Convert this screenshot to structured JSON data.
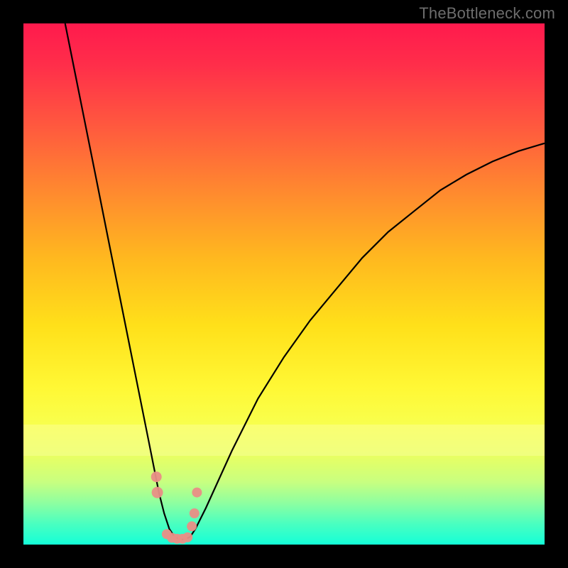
{
  "watermark": {
    "text": "TheBottleneck.com"
  },
  "chart_data": {
    "type": "line",
    "title": "",
    "xlabel": "",
    "ylabel": "",
    "xlim": [
      0,
      100
    ],
    "ylim": [
      0,
      100
    ],
    "grid": false,
    "legend": false,
    "background_gradient": {
      "orientation": "vertical",
      "top_color": "#ff1a4d",
      "bottom_color": "#14ffd8"
    },
    "series": [
      {
        "name": "main-curve",
        "color": "#000000",
        "x": [
          8,
          10,
          12,
          14,
          16,
          18,
          20,
          22,
          24,
          26,
          27,
          28,
          29,
          30,
          31,
          32,
          33,
          35,
          40,
          45,
          50,
          55,
          60,
          65,
          70,
          75,
          80,
          85,
          90,
          95,
          100
        ],
        "y": [
          100,
          90,
          80,
          70,
          60,
          50,
          40,
          30,
          20,
          10,
          6,
          3,
          1.5,
          1,
          1,
          1.5,
          3,
          7,
          18,
          28,
          36,
          43,
          49,
          55,
          60,
          64,
          68,
          71,
          73.5,
          75.5,
          77
        ]
      },
      {
        "name": "highlight-dots",
        "color": "#e98e86",
        "type": "scatter",
        "x": [
          25.5,
          25.7,
          27.5,
          28.5,
          29.5,
          30.5,
          31.5,
          32.3,
          32.8,
          33.3
        ],
        "y": [
          13,
          10,
          2,
          1.3,
          1.1,
          1.1,
          1.4,
          3.5,
          6,
          10
        ]
      }
    ]
  }
}
